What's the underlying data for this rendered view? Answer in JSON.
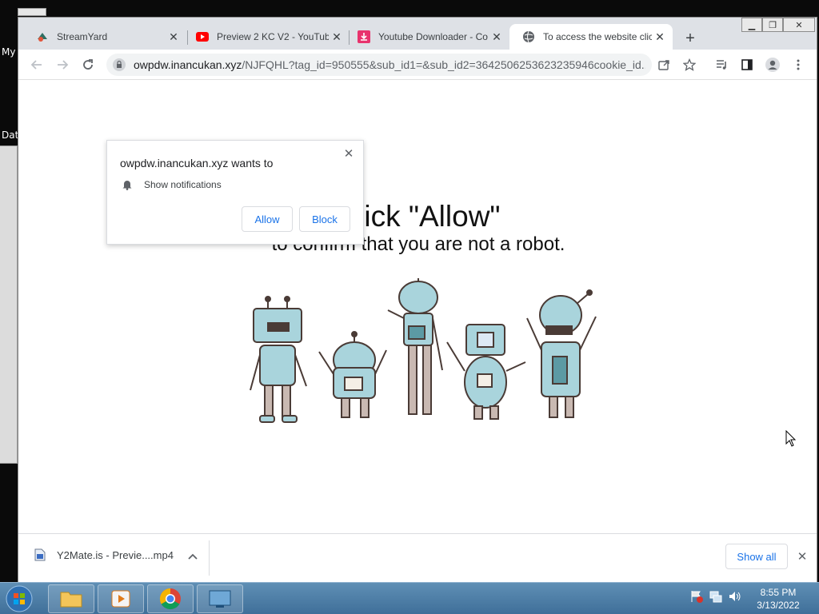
{
  "desktop": {
    "icon_label_1": "My",
    "icon_label_2": "Dat"
  },
  "tabs": [
    {
      "title": "StreamYard",
      "icon": "streamyard-icon"
    },
    {
      "title": "Preview 2 KC V2 - YouTube",
      "icon": "youtube-icon"
    },
    {
      "title": "Youtube Downloader - Co",
      "icon": "download-icon"
    },
    {
      "title": "To access the website clic",
      "icon": "globe-icon",
      "active": true
    }
  ],
  "toolbar": {
    "url_host": "owpdw.inancukan.xyz",
    "url_path": "/NJFQHL?tag_id=950555&sub_id1=&sub_id2=3642506253623235946cookie_id..."
  },
  "popup": {
    "title": "owpdw.inancukan.xyz wants to",
    "permission": "Show notifications",
    "allow_label": "Allow",
    "block_label": "Block"
  },
  "page": {
    "headline": "Click \"Allow\"",
    "subline": "to confirm that you are not a robot."
  },
  "download": {
    "filename": "Y2Mate.is - Previe....mp4",
    "show_all_label": "Show all"
  },
  "taskbar": {
    "time": "8:55 PM",
    "date": "3/13/2022"
  },
  "colors": {
    "accent": "#1a73e8",
    "robot_fill": "#a9d4dc",
    "robot_stroke": "#4a3b36"
  }
}
